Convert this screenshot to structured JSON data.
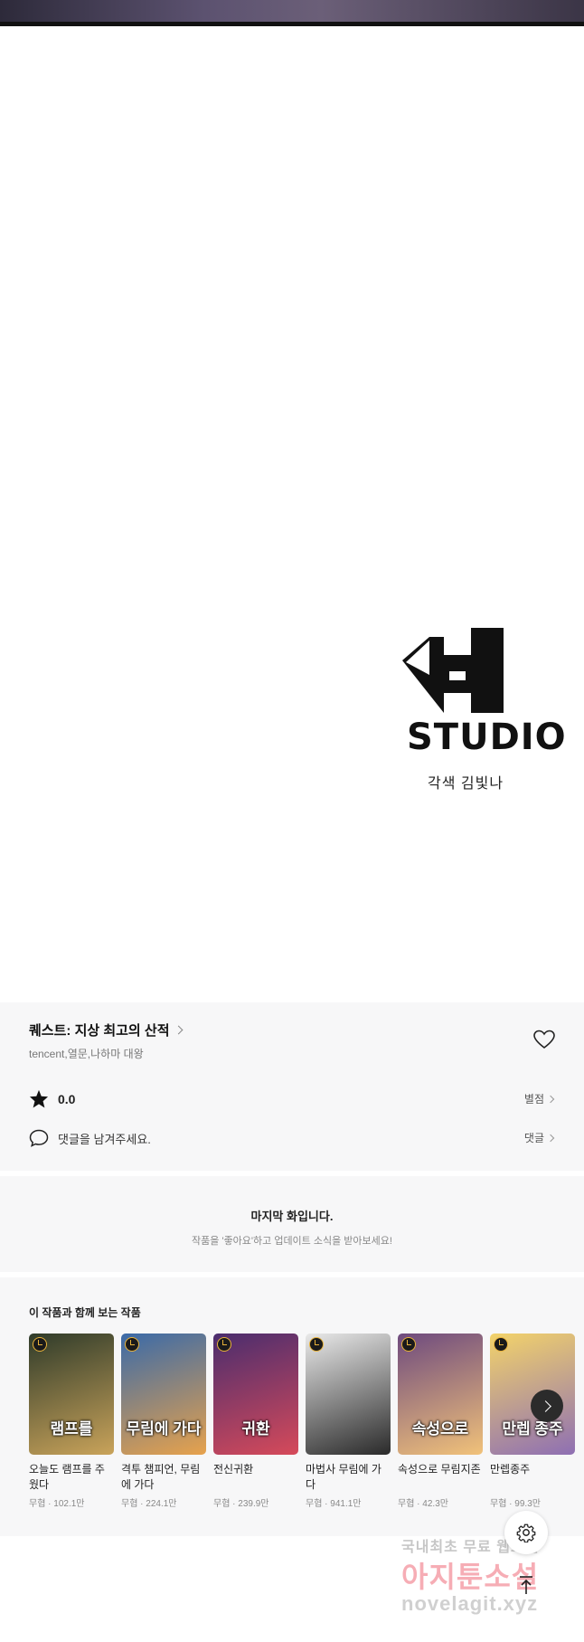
{
  "studio": {
    "logo_word": "STUDIO",
    "credit": "각색 김빛나"
  },
  "work": {
    "title": "퀘스트: 지상 최고의 산적",
    "authors": "tencent,열문,나하마 대왕",
    "rating": "0.0",
    "rate_label": "별점",
    "comment_prompt": "댓글을 남겨주세요.",
    "comment_label": "댓글"
  },
  "last_episode": {
    "title": "마지막 화입니다.",
    "subtitle": "작품을 '좋아요'하고 업데이트 소식을 받아보세요!"
  },
  "recommendations": {
    "heading": "이 작품과 함께 보는 작품",
    "items": [
      {
        "title": "오늘도 램프를 주웠다",
        "meta": "무협 · 102.1만",
        "cover_text": "램프를",
        "color1": "#2f3b2a",
        "color2": "#c9a35a"
      },
      {
        "title": "격투 챔피언, 무림에 가다",
        "meta": "무협 · 224.1만",
        "cover_text": "무림에 가다",
        "color1": "#3a6aa8",
        "color2": "#e7a24c"
      },
      {
        "title": "전신귀환",
        "meta": "무협 · 239.9만",
        "cover_text": "귀환",
        "color1": "#4a2d6e",
        "color2": "#d64a5a"
      },
      {
        "title": "마법사 무림에 가다",
        "meta": "무협 · 941.1만",
        "cover_text": "",
        "color1": "#e9e9e9",
        "color2": "#2a2a2a"
      },
      {
        "title": "속성으로 무림지존",
        "meta": "무협 · 42.3만",
        "cover_text": "속성으로",
        "color1": "#6e4a7e",
        "color2": "#f1c27a"
      },
      {
        "title": "만렙종주",
        "meta": "무협 · 99.3만",
        "cover_text": "만렙 종주",
        "color1": "#f3d36a",
        "color2": "#8e6fb3"
      }
    ]
  },
  "watermark": {
    "line1": "국내최초 무료 웹소설",
    "line2": "아지툰소설",
    "line3": "novelagit.xyz"
  }
}
